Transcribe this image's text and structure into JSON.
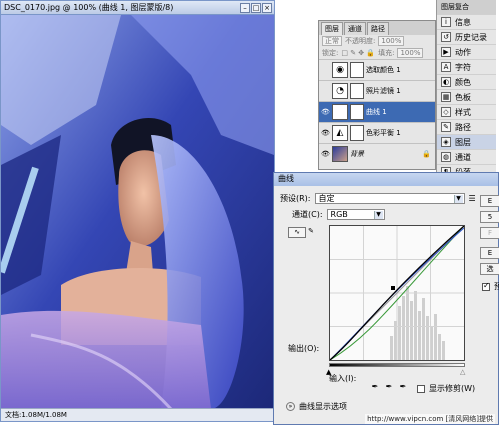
{
  "doc": {
    "title": "DSC_0170.jpg @ 100% (曲线 1, 图层蒙版/8)",
    "status": "文档:1.08M/1.08M"
  },
  "layers_panel": {
    "tabs": [
      "图层",
      "通道",
      "路径"
    ],
    "blend_mode": "正常",
    "opacity_label": "不透明度:",
    "opacity_value": "100%",
    "lock_label": "锁定:",
    "fill_label": "填充:",
    "fill_value": "100%",
    "layers": [
      {
        "name": "选取颜色 1",
        "visible": false,
        "selected": false
      },
      {
        "name": "照片滤镜 1",
        "visible": false,
        "selected": false
      },
      {
        "name": "曲线 1",
        "visible": true,
        "selected": true
      },
      {
        "name": "色彩平衡 1",
        "visible": true,
        "selected": false
      },
      {
        "name": "背景",
        "visible": true,
        "selected": false
      }
    ]
  },
  "side_panel": {
    "top_label": "图层复合",
    "items": [
      "信息",
      "历史记录",
      "动作",
      "字符",
      "颜色",
      "色板",
      "样式",
      "路径",
      "图层",
      "通道",
      "段落"
    ],
    "active": "图层"
  },
  "curves": {
    "title": "曲线",
    "preset_label": "预设(R):",
    "preset_value": "自定",
    "channel_label": "通道(C):",
    "channel_value": "RGB",
    "output_label": "输出(O):",
    "input_label": "输入(I):",
    "show_clipping": "显示修剪(W)",
    "display_options": "曲线显示选项",
    "preview_label": "预",
    "buttons": [
      "E",
      "5",
      "F",
      "E",
      "选"
    ]
  },
  "watermark": "http://www.vipcn.com [清风网络]提供"
}
